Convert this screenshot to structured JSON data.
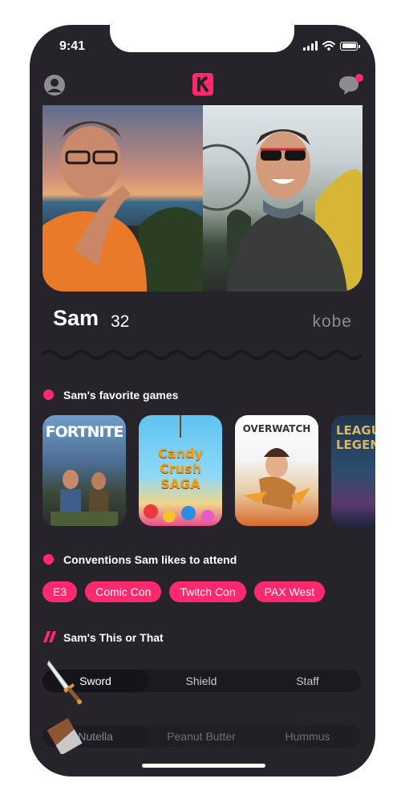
{
  "status": {
    "time": "9:41"
  },
  "profile": {
    "name": "Sam",
    "age": "32",
    "handle": "kobe"
  },
  "games_section": {
    "title": "Sam's favorite games",
    "games": [
      {
        "label": "FORTNITE",
        "icon": "fortnite-cover"
      },
      {
        "label": "Candy Crush SAGA",
        "icon": "candy-crush-cover"
      },
      {
        "label": "OVERWATCH",
        "icon": "overwatch-cover"
      },
      {
        "label": "LEAGUE OF LEGENDS",
        "icon": "league-cover"
      }
    ]
  },
  "conventions_section": {
    "title": "Conventions Sam likes to attend",
    "chips": [
      "E3",
      "Comic Con",
      "Twitch Con",
      "PAX West"
    ]
  },
  "this_or_that": {
    "title": "Sam's This or That",
    "rows": [
      {
        "options": [
          "Sword",
          "Shield",
          "Staff"
        ],
        "selected": 0,
        "icon": "sword-icon"
      },
      {
        "options": [
          "Nutella",
          "Peanut Butter",
          "Hummus"
        ],
        "selected": 0,
        "icon": "chocolate-icon"
      }
    ]
  },
  "colors": {
    "accent": "#ff2a6d",
    "background": "#26232a"
  }
}
